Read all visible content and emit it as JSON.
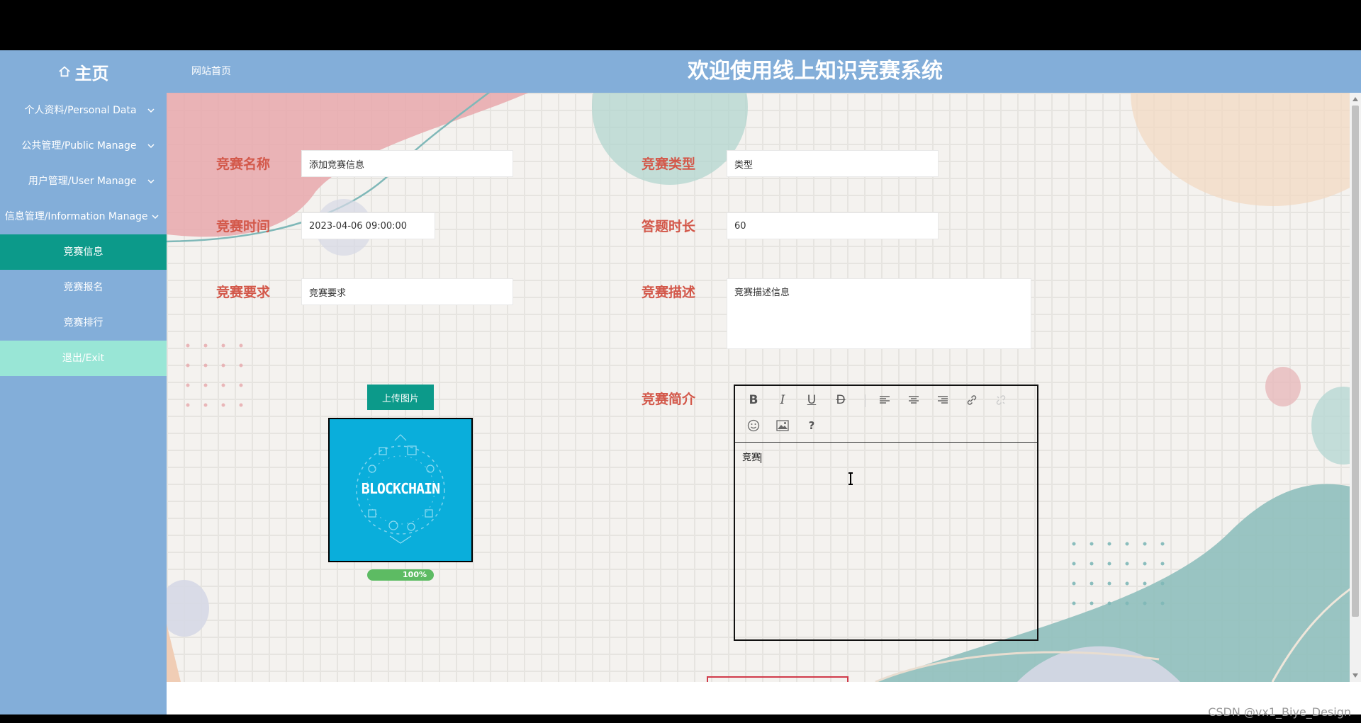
{
  "header": {
    "home_label": "主页",
    "site_home_link": "网站首页",
    "system_title": "欢迎使用线上知识竞赛系统"
  },
  "sidebar": {
    "menus": [
      {
        "label": "个人资料/Personal Data"
      },
      {
        "label": "公共管理/Public Manage"
      },
      {
        "label": "用户管理/User Manage"
      },
      {
        "label": "信息管理/Information Manage"
      }
    ],
    "submenu": [
      {
        "label": "竞赛信息",
        "active": true
      },
      {
        "label": "竞赛报名",
        "active": false
      },
      {
        "label": "竞赛排行",
        "active": false
      }
    ],
    "exit_label": "退出/Exit"
  },
  "form": {
    "name": {
      "label": "竞赛名称",
      "value": "添加竞赛信息"
    },
    "type": {
      "label": "竞赛类型",
      "value": "类型"
    },
    "time": {
      "label": "竞赛时间",
      "value": "2023-04-06 09:00:00"
    },
    "duration": {
      "label": "答题时长",
      "value": "60"
    },
    "requirement": {
      "label": "竞赛要求",
      "value": "竞赛要求"
    },
    "description": {
      "label": "竞赛描述",
      "value": "竞赛描述信息"
    },
    "intro": {
      "label": "竞赛简介",
      "content": "竞赛"
    },
    "upload_button": "上传图片",
    "upload_progress": "100%",
    "upload_progress_value": 100,
    "preview_image_text": "BLOCKCHAIN"
  },
  "editor": {
    "tools": [
      {
        "name": "bold-icon",
        "glyph": "B"
      },
      {
        "name": "italic-icon",
        "glyph": "I"
      },
      {
        "name": "underline-icon",
        "glyph": "U"
      },
      {
        "name": "strikethrough-icon",
        "glyph": "D"
      },
      {
        "name": "align-left-icon",
        "glyph": ""
      },
      {
        "name": "align-center-icon",
        "glyph": ""
      },
      {
        "name": "align-right-icon",
        "glyph": ""
      },
      {
        "name": "link-icon",
        "glyph": ""
      },
      {
        "name": "unlink-icon",
        "glyph": ""
      },
      {
        "name": "emoji-icon",
        "glyph": ""
      },
      {
        "name": "image-icon",
        "glyph": ""
      },
      {
        "name": "help-icon",
        "glyph": "?"
      }
    ]
  },
  "watermark": "CSDN @vx1_Biye_Design",
  "colors": {
    "sidebar": "#83aed9",
    "active": "#0c9a8a",
    "exit": "#99e6d6",
    "label": "#d3584a"
  }
}
